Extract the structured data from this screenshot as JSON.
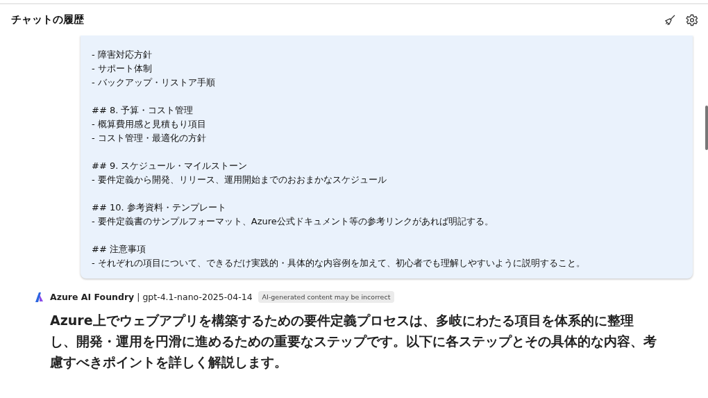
{
  "header": {
    "title": "チャットの履歴"
  },
  "user_message": {
    "blocks": [
      [
        "- 障害対応方針",
        "- サポート体制",
        "- バックアップ・リストア手順"
      ],
      [
        "## 8. 予算・コスト管理",
        "- 概算費用感と見積もり項目",
        "- コスト管理・最適化の方針"
      ],
      [
        "## 9. スケジュール・マイルストーン",
        "- 要件定義から開発、リリース、運用開始までのおおまかなスケジュール"
      ],
      [
        "## 10. 参考資料・テンプレート",
        "- 要件定義書のサンプルフォーマット、Azure公式ドキュメント等の参考リンクがあれば明記する。"
      ],
      [
        "## 注意事項",
        "- それぞれの項目について、できるだけ実践的・具体的な内容例を加えて、初心者でも理解しやすいように説明すること。"
      ]
    ]
  },
  "assistant_message": {
    "source": "Azure AI Foundry",
    "separator": "|",
    "model": "gpt-4.1-nano-2025-04-14",
    "badge": "AI-generated content may be incorrect",
    "text": "Azure上でウェブアプリを構築するための要件定義プロセスは、多岐にわたる項目を体系的に整理し、開発・運用を円滑に進めるための重要なステップです。以下に各ステップとその具体的な内容、考慮すべきポイントを詳しく解説します。"
  }
}
